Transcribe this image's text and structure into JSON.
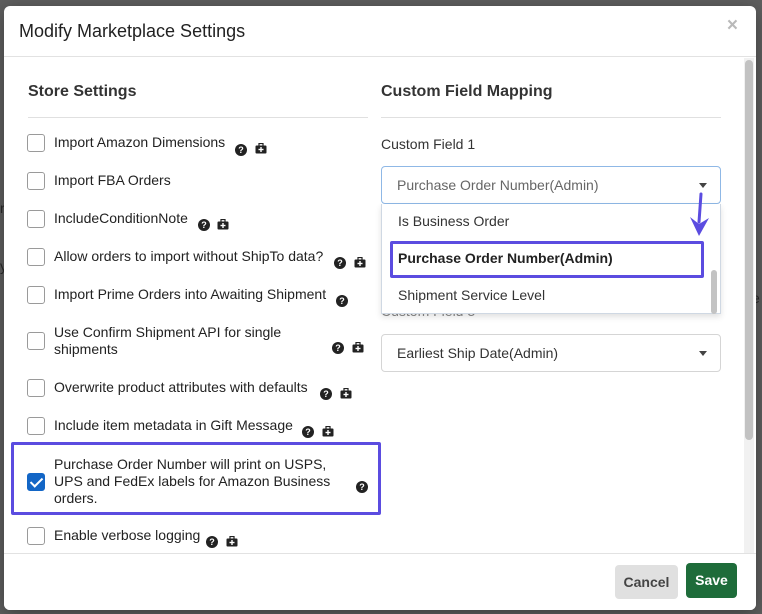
{
  "modal": {
    "title": "Modify Marketplace Settings",
    "close_label": "×"
  },
  "store_settings": {
    "heading": "Store Settings",
    "options": [
      {
        "label": "Import Amazon Dimensions",
        "checked": false
      },
      {
        "label": "Import FBA Orders",
        "checked": false
      },
      {
        "label": "IncludeConditionNote",
        "checked": false
      },
      {
        "label": "Allow orders to import without ShipTo data?",
        "checked": false
      },
      {
        "label": "Import Prime Orders into Awaiting Shipment",
        "checked": false
      },
      {
        "label_line1": "Use Confirm Shipment API for single",
        "label_line2": "shipments",
        "checked": false
      },
      {
        "label": "Overwrite product attributes with defaults",
        "checked": false
      },
      {
        "label": "Include item metadata in Gift Message",
        "checked": false
      },
      {
        "label_line1": "Purchase Order Number will print on USPS,",
        "label_line2": "UPS and FedEx labels for Amazon Business",
        "label_line3": "orders.",
        "checked": true
      },
      {
        "label": "Enable verbose logging",
        "checked": false
      }
    ]
  },
  "custom_field_mapping": {
    "heading": "Custom Field Mapping",
    "field1_label": "Custom Field 1",
    "field1_value": "Purchase Order Number(Admin)",
    "dropdown_options": [
      "Is Business Order",
      "Purchase Order Number(Admin)",
      "Shipment Service Level"
    ],
    "field3_partial_label": "Custom Field 3",
    "field3_value": "Earliest Ship Date(Admin)"
  },
  "footer": {
    "cancel_label": "Cancel",
    "save_label": "Save"
  },
  "colors": {
    "highlight": "#5b4ce0",
    "save_button": "#1e6c3a",
    "checkbox_checked": "#1366c6"
  },
  "icons": [
    "help-icon",
    "medkit-icon",
    "close-icon",
    "chevron-down-icon",
    "down-arrow-annotation-icon"
  ]
}
